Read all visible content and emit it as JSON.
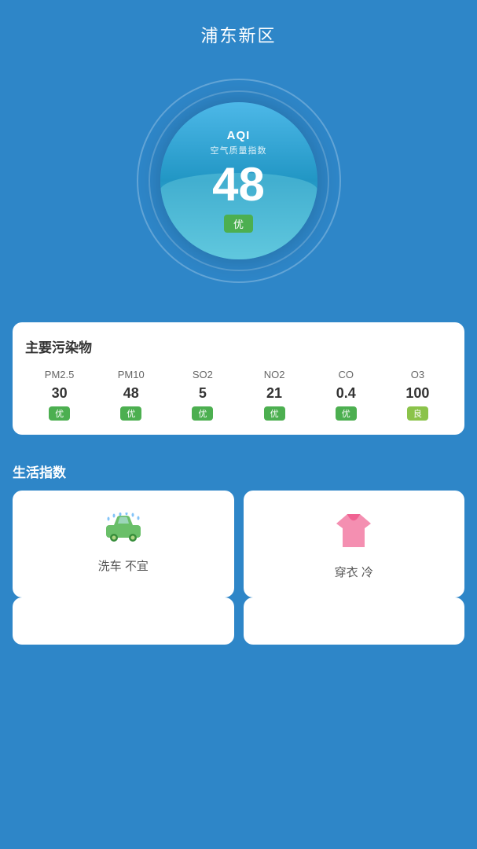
{
  "header": {
    "title": "浦东新区"
  },
  "aqi": {
    "label": "AQI",
    "sublabel": "空气质量指数",
    "value": "48",
    "badge": "优"
  },
  "pollutants": {
    "section_title": "主要污染物",
    "items": [
      {
        "name": "PM2.5",
        "value": "30",
        "badge": "优",
        "level": "good"
      },
      {
        "name": "PM10",
        "value": "48",
        "badge": "优",
        "level": "good"
      },
      {
        "name": "SO2",
        "value": "5",
        "badge": "优",
        "level": "good"
      },
      {
        "name": "NO2",
        "value": "21",
        "badge": "优",
        "level": "good"
      },
      {
        "name": "CO",
        "value": "0.4",
        "badge": "优",
        "level": "good"
      },
      {
        "name": "O3",
        "value": "100",
        "badge": "良",
        "level": "moderate"
      }
    ]
  },
  "life_index": {
    "section_title": "生活指数",
    "items": [
      {
        "id": "car-wash",
        "icon": "car",
        "label": "洗车 不宜"
      },
      {
        "id": "clothing",
        "icon": "shirt",
        "label": "穿衣 冷"
      }
    ]
  },
  "colors": {
    "background": "#2e86c8",
    "card_bg": "#ffffff",
    "good_badge": "#4caf50",
    "moderate_badge": "#8bc34a",
    "car_icon": "#6abf69",
    "shirt_icon": "#f48fb1"
  }
}
